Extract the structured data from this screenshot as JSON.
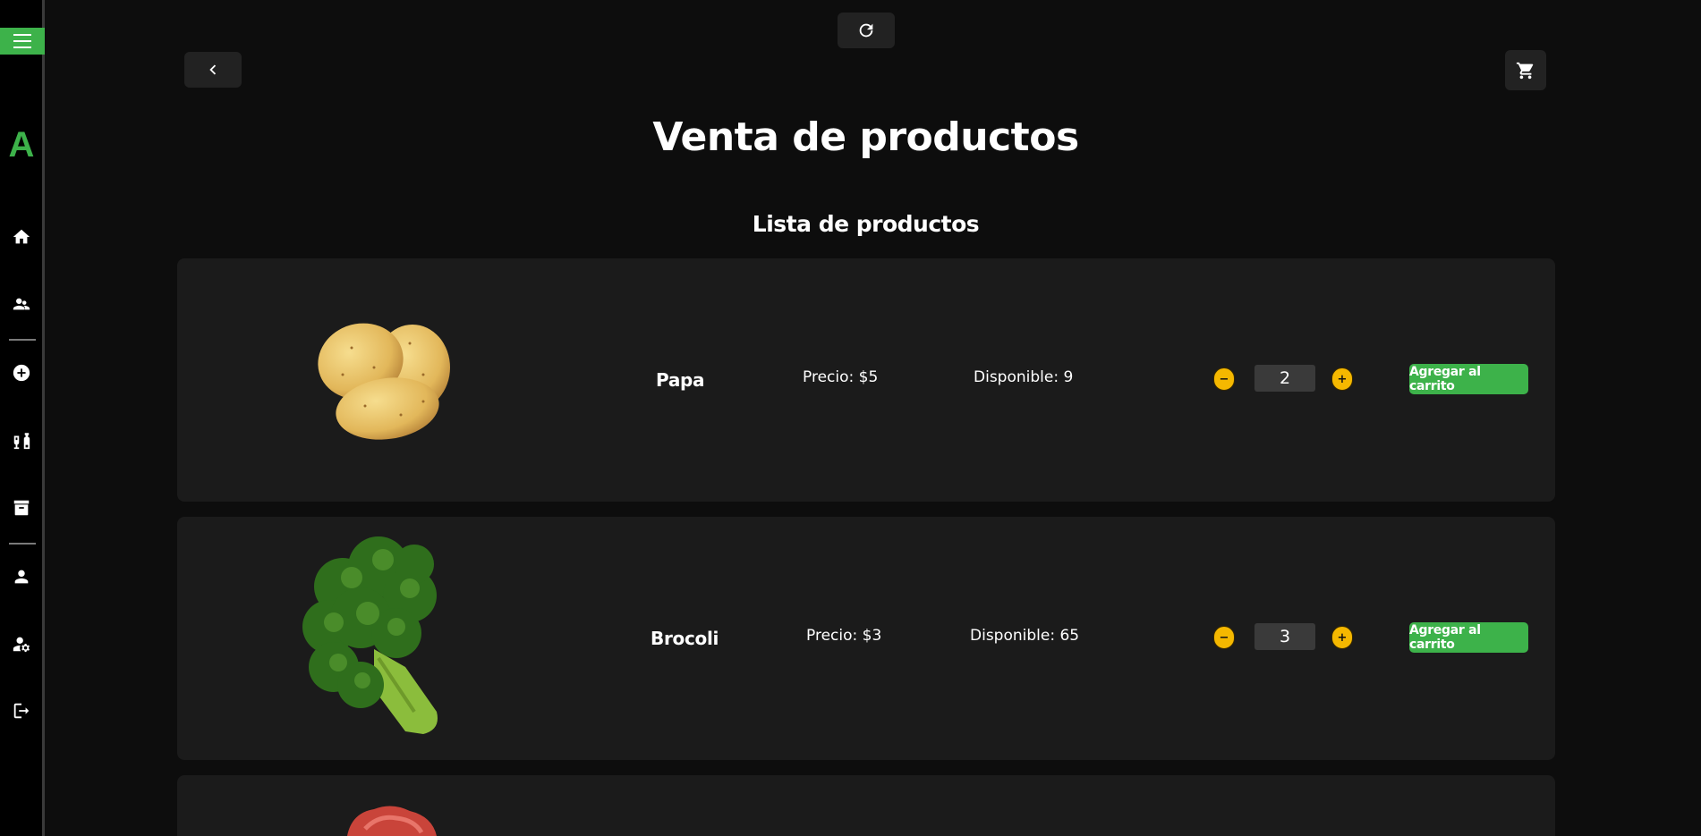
{
  "sidebar": {
    "logo": "A",
    "items": [
      {
        "icon": "home-icon"
      },
      {
        "icon": "people-icon"
      },
      {
        "icon": "add-circle-icon"
      },
      {
        "icon": "liquor-icon"
      },
      {
        "icon": "archive-icon"
      },
      {
        "icon": "person-icon"
      },
      {
        "icon": "manage-accounts-icon"
      },
      {
        "icon": "logout-icon"
      }
    ]
  },
  "header": {
    "title": "Venta de productos",
    "section_title": "Lista de productos"
  },
  "products": [
    {
      "name": "Papa",
      "price": "Precio: $5",
      "stock": "Disponible: 9",
      "qty": "2",
      "minus": "−",
      "plus": "+",
      "add_label": "Agregar al carrito"
    },
    {
      "name": "Brocoli",
      "price": "Precio: $3",
      "stock": "Disponible: 65",
      "qty": "3",
      "minus": "−",
      "plus": "+",
      "add_label": "Agregar al carrito"
    }
  ],
  "colors": {
    "accent": "#3db24a",
    "qty_button": "#f5b800",
    "card_bg": "#1b1b1b",
    "page_bg": "#0d0d0d"
  }
}
